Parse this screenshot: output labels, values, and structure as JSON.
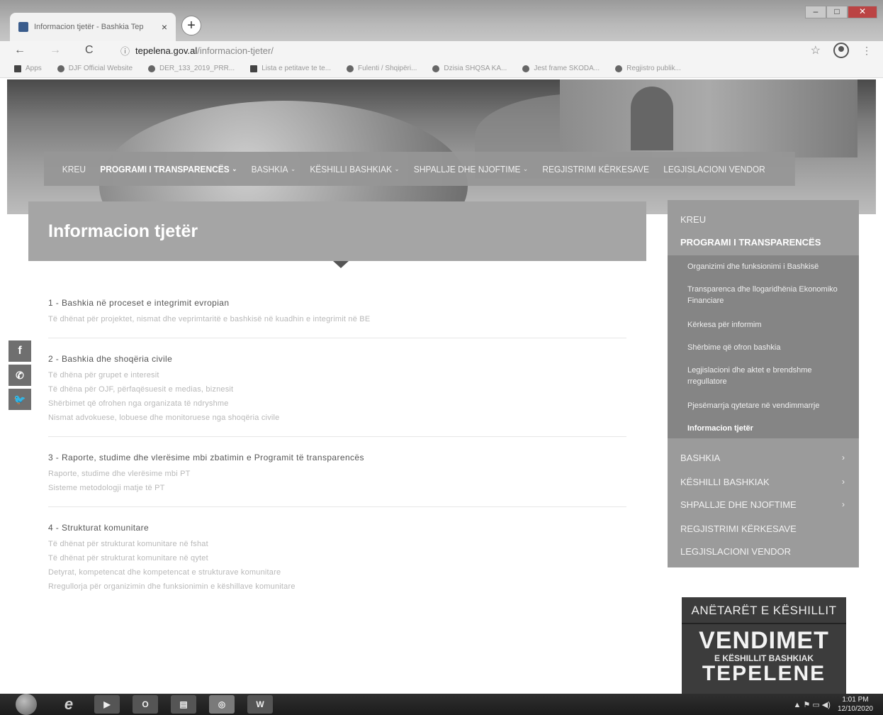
{
  "browser": {
    "tab_title": "Informacion tjetër - Bashkia Tep",
    "tab_close": "×",
    "new_tab": "+",
    "url_host": "tepelena.gov.al",
    "url_path": "/informacion-tjeter/",
    "nav_back": "←",
    "nav_forward": "→",
    "nav_reload": "C",
    "info": "ⓘ",
    "star": "☆",
    "menu": "⋮",
    "win_min": "–",
    "win_max": "□",
    "win_close": "✕",
    "bookmarks": [
      "Apps",
      "DJF Official Website",
      "DER_133_2019_PRR...",
      "Lista e petitave te te...",
      "Fulenti / Shqipëri...",
      "Dzisia SHQSA KA...",
      "Jest frame SKODA...",
      "Regjistro publik..."
    ]
  },
  "site": {
    "nav": [
      {
        "label": "KREU",
        "caret": ""
      },
      {
        "label": "PROGRAMI I TRANSPARENCËS",
        "caret": "⌄"
      },
      {
        "label": "BASHKIA",
        "caret": "⌄"
      },
      {
        "label": "KËSHILLI BASHKIAK",
        "caret": "⌄"
      },
      {
        "label": "SHPALLJE DHE NJOFTIME",
        "caret": "⌄"
      },
      {
        "label": "REGJISTRIMI KËRKESAVE",
        "caret": ""
      },
      {
        "label": "LEGJISLACIONI VENDOR",
        "caret": ""
      }
    ],
    "page_title": "Informacion tjetër",
    "sections": [
      {
        "title": "1 - Bashkia në proceset e integrimit evropian",
        "links": [
          "Të dhënat për projektet, nismat dhe veprimtaritë e bashkisë në kuadhin e integrimit në BE"
        ]
      },
      {
        "title": "2 - Bashkia dhe shoqëria civile",
        "links": [
          "Të dhëna për grupet e interesit",
          "Të dhëna për OJF, përfaqësuesit e medias, biznesit",
          "Shërbimet që ofrohen nga organizata të ndryshme",
          "Nismat advokuese, lobuese dhe monitoruese nga shoqëria civile"
        ]
      },
      {
        "title": "3 - Raporte, studime dhe vlerësime mbi zbatimin e Programit të transparencës",
        "links": [
          "Raporte, studime dhe vlerësime mbi PT",
          "Sisteme metodologji matje të PT"
        ]
      },
      {
        "title": "4 - Strukturat komunitare",
        "links": [
          "Të dhënat për strukturat komunitare në fshat",
          "Të dhënat për strukturat komunitare në qytet",
          "Detyrat, kompetencat dhe kompetencat e strukturave komunitare",
          "Rregullorja për organizimin dhe funksionimin e këshillave komunitare"
        ]
      }
    ],
    "social": {
      "facebook": "f",
      "whatsapp": "✆",
      "twitter": "🐦"
    },
    "sidebar": {
      "kreu": "KREU",
      "programi": "PROGRAMI I TRANSPARENCËS",
      "sub": [
        "Organizimi dhe funksionimi i Bashkisë",
        "Transparenca dhe llogaridhënia Ekonomiko Financiare",
        "Kërkesa për informim",
        "Shërbime që ofron bashkia",
        "Legjislacioni dhe aktet e brendshme rregullatore",
        "Pjesëmarrja qytetare në vendimmarrje",
        "Informacion tjetër"
      ],
      "bottom": [
        {
          "label": "BASHKIA",
          "arrow": "›"
        },
        {
          "label": "KËSHILLI BASHKIAK",
          "arrow": "›"
        },
        {
          "label": "SHPALLJE DHE NJOFTIME",
          "arrow": "›"
        },
        {
          "label": "REGJISTRIMI KËRKESAVE",
          "arrow": ""
        },
        {
          "label": "LEGJISLACIONI VENDOR",
          "arrow": ""
        }
      ]
    },
    "banner": {
      "top": "ANËTARËT E KËSHILLIT",
      "main": "VENDIMET",
      "sub": "E KËSHILLIT BASHKIAK",
      "city": "TEPELENE"
    }
  },
  "taskbar": {
    "ie": "e",
    "outlook": "O",
    "word": "W",
    "clock_time": "1:01 PM",
    "clock_date": "12/10/2020",
    "tray_icons": "▲ ⚑ ▭ ◀)"
  }
}
